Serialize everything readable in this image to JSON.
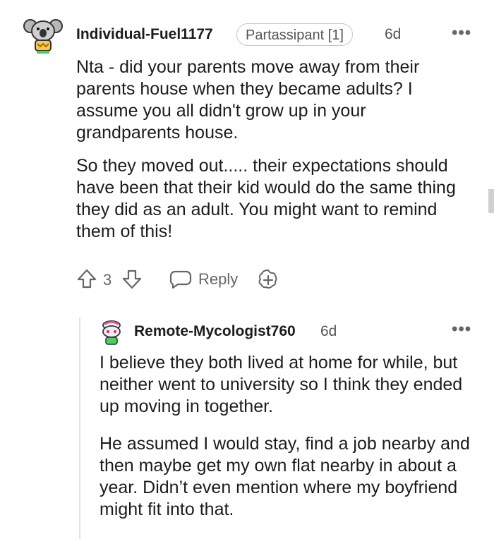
{
  "comment": {
    "username": "Individual-Fuel1177",
    "flair": "Partassipant [1]",
    "time": "6d",
    "paragraphs": [
      "Nta - did your parents move away from their parents house when they became adults? I assume you all didn't grow up in your grandparents house.",
      "So they moved out..... their expectations should have been that their kid would do the same thing they did as an adult. You might want to remind them of this!"
    ],
    "votes": "3",
    "reply_label": "Reply"
  },
  "reply": {
    "username": "Remote-Mycologist760",
    "time": "6d",
    "paragraphs": [
      "I believe they both lived at home for while, but neither went to university so I think they ended up moving in together.",
      "He assumed I would stay, find a job nearby and then maybe get my own flat nearby in about a year. Didn’t even mention where my boyfriend might fit into that."
    ]
  },
  "icons": [
    "avatar-koala-icon",
    "upvote-icon",
    "downvote-icon",
    "reply-icon",
    "award-icon",
    "more-icon",
    "avatar-snoo-icon"
  ],
  "colors": {
    "text": "#1c1c1c",
    "meta": "#555555",
    "border": "#c8c8c8"
  }
}
